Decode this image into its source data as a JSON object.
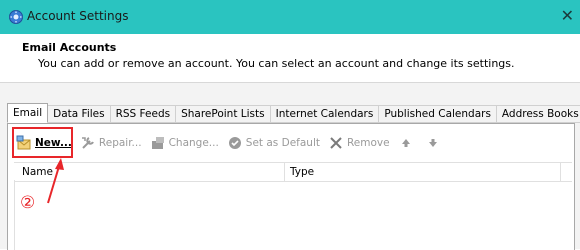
{
  "window": {
    "title": "Account Settings",
    "close_glyph": "✕"
  },
  "header": {
    "title": "Email Accounts",
    "description": "You can add or remove an account. You can select an account and change its settings."
  },
  "tabs": [
    {
      "label": "Email",
      "active": true
    },
    {
      "label": "Data Files",
      "active": false
    },
    {
      "label": "RSS Feeds",
      "active": false
    },
    {
      "label": "SharePoint Lists",
      "active": false
    },
    {
      "label": "Internet Calendars",
      "active": false
    },
    {
      "label": "Published Calendars",
      "active": false
    },
    {
      "label": "Address Books",
      "active": false
    }
  ],
  "toolbar": {
    "new_label": "New...",
    "repair_label": "Repair...",
    "change_label": "Change...",
    "set_default_label": "Set as Default",
    "remove_label": "Remove",
    "move_up_icon": "arrow-up-icon",
    "move_down_icon": "arrow-down-icon"
  },
  "list": {
    "columns": [
      "Name",
      "Type"
    ]
  },
  "annotation": {
    "step_marker": "②",
    "color": "#e8262a"
  },
  "colors": {
    "titlebar": "#2ac4c0"
  }
}
